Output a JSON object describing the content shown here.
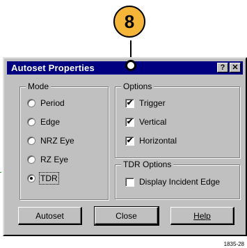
{
  "callout": {
    "number": "8",
    "color": "#f5b638"
  },
  "dialog": {
    "title": "Autoset Properties",
    "help_button": "?",
    "close_button": "✕",
    "mode": {
      "legend": "Mode",
      "selected": "TDR",
      "options": [
        "Period",
        "Edge",
        "NRZ Eye",
        "RZ Eye",
        "TDR"
      ]
    },
    "options": {
      "legend": "Options",
      "items": [
        {
          "label": "Trigger",
          "checked": true
        },
        {
          "label": "Vertical",
          "checked": true
        },
        {
          "label": "Horizontal",
          "checked": true
        }
      ]
    },
    "tdr_options": {
      "legend": "TDR Options",
      "items": [
        {
          "label": "Display Incident Edge",
          "checked": false
        }
      ]
    },
    "buttons": {
      "autoset": "Autoset",
      "close": "Close",
      "help": "Help"
    }
  },
  "figure_number": "1835-28"
}
